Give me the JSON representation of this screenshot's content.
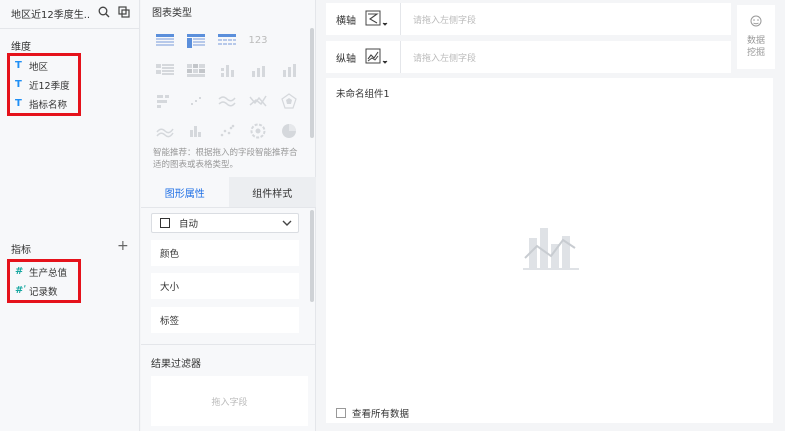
{
  "left": {
    "title": "地区近12季度生...",
    "dimension_label": "维度",
    "dimensions": [
      {
        "type": "T",
        "label": "地区"
      },
      {
        "type": "T",
        "label": "近12季度"
      },
      {
        "type": "T",
        "label": "指标名称"
      }
    ],
    "measure_label": "指标",
    "add": "+",
    "measures": [
      {
        "type": "#",
        "label": "生产总值"
      },
      {
        "type": "#ʹ",
        "label": "记录数"
      }
    ]
  },
  "middle": {
    "chart_types_label": "图表类型",
    "chart_type_icons": [
      "table-icon",
      "crosstab-icon",
      "detail-table-icon",
      "kpi-number-icon",
      "blank",
      "grouped-table-icon",
      "heatmap-table-icon",
      "column-icon",
      "stacked-column-icon",
      "percent-column-icon",
      "bar-icon",
      "scatter-small-icon",
      "line-icon",
      "radar-line-icon",
      "radar-icon",
      "area-icon",
      "bar-variant-icon",
      "scatter-icon",
      "sunburst-icon",
      "pie-icon"
    ],
    "kpi_text": "123",
    "hint": "智能推荐：根据拖入的字段智能推荐合适的图表或表格类型。",
    "tabs": [
      "图形属性",
      "组件样式"
    ],
    "select_value": "自动",
    "props": [
      "颜色",
      "大小",
      "标签"
    ],
    "filter_label": "结果过滤器",
    "drop_placeholder": "拖入字段"
  },
  "axes": {
    "x_label": "横轴",
    "y_label": "纵轴",
    "placeholder": "请拖入左侧字段"
  },
  "mining": {
    "line1": "数据",
    "line2": "挖掘"
  },
  "canvas": {
    "component_name": "未命名组件1",
    "show_all_label": "查看所有数据"
  },
  "colors": {
    "accent": "#1f6fe5",
    "dimension_type": "#1f8ff5",
    "measure_type": "#17a7a1",
    "highlight_box": "#e5121b"
  }
}
